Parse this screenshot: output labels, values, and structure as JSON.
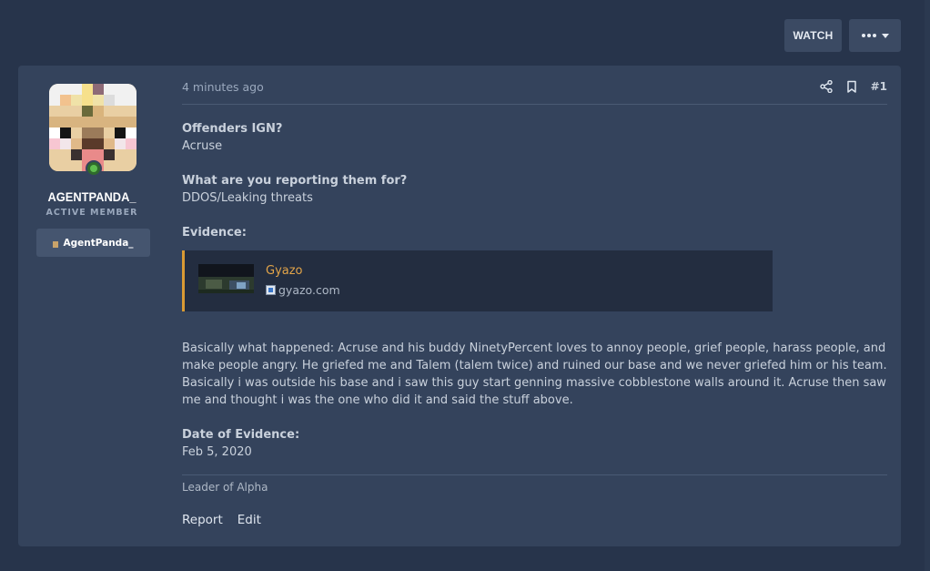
{
  "thread_actions": {
    "watch_label": "WATCH",
    "more_label": "more-options"
  },
  "user": {
    "name": "AGENTPANDA_",
    "title": "ACTIVE MEMBER",
    "badge_label": "AgentPanda_",
    "online": true
  },
  "post": {
    "time": "4 minutes ago",
    "number": "#1",
    "fields": [
      {
        "label": "Offenders IGN?",
        "value": "Acruse"
      },
      {
        "label": "What are you reporting them for?",
        "value": "DDOS/Leaking threats"
      },
      {
        "label": "Evidence:",
        "value": ""
      }
    ],
    "embed": {
      "title": "Gyazo",
      "site": "gyazo.com"
    },
    "body_lines": [
      "Basically what happened: Acruse and his buddy NinetyPercent loves to annoy people, grief people, harass people, and",
      "make people angry. He griefed me and Talem (talem twice) and ruined our base and we never griefed him or his team.",
      "Basically i was outside his base and i saw this guy start genning massive cobblestone walls around it. Acruse then saw",
      "me and thought i was the one who did it and said the stuff above."
    ],
    "date_label": "Date of Evidence:",
    "date_value": "Feb 5, 2020",
    "signature": "Leader of Alpha",
    "report_label": "Report",
    "edit_label": "Edit"
  },
  "colors": {
    "page_bg": "#27344b",
    "card_bg": "#34435c",
    "accent": "#e2a449",
    "online": "#5fbf4f"
  }
}
